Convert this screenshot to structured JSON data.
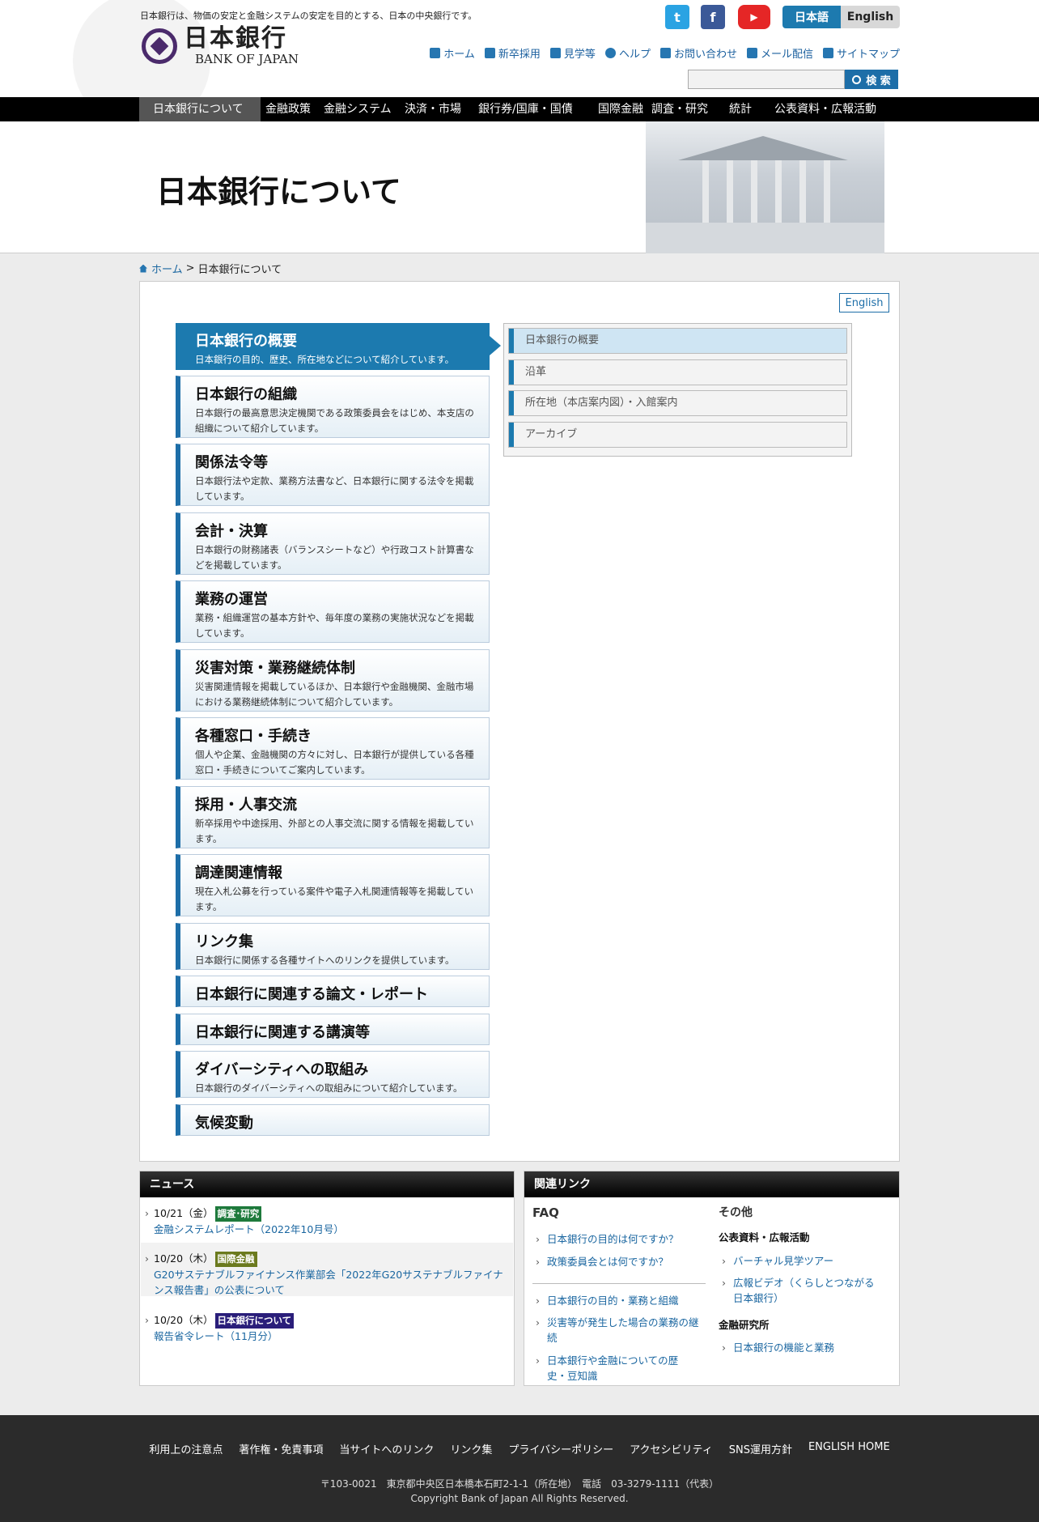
{
  "header": {
    "tagline": "日本銀行は、物価の安定と金融システムの安定を目的とする、日本の中央銀行です。",
    "logo_jp": "日本銀行",
    "logo_en": "BANK OF JAPAN",
    "social": [
      "twitter-icon",
      "facebook-icon",
      "youtube-icon"
    ],
    "lang_ja": "日本語",
    "lang_en": "English",
    "util": [
      "ホーム",
      "新卒採用",
      "見学等",
      "ヘルプ",
      "お問い合わせ",
      "メール配信",
      "サイトマップ"
    ],
    "search_placeholder": "",
    "search_button": "検 索"
  },
  "gnav": [
    "日本銀行について",
    "金融政策",
    "金融システム",
    "決済・市場",
    "銀行券/国庫・国債",
    "国際金融",
    "調査・研究",
    "統計",
    "公表資料・広報活動"
  ],
  "hero_title": "日本銀行について",
  "breadcrumb": {
    "home": "ホーム",
    "sep": ">",
    "current": "日本銀行について"
  },
  "english_button": "English",
  "menu": [
    {
      "title": "日本銀行の概要",
      "desc": "日本銀行の目的、歴史、所在地などについて紹介しています。"
    },
    {
      "title": "日本銀行の組織",
      "desc": "日本銀行の最高意思決定機関である政策委員会をはじめ、本支店の組織について紹介しています。"
    },
    {
      "title": "関係法令等",
      "desc": "日本銀行法や定款、業務方法書など、日本銀行に関する法令を掲載しています。"
    },
    {
      "title": "会計・決算",
      "desc": "日本銀行の財務諸表（バランスシートなど）や行政コスト計算書などを掲載しています。"
    },
    {
      "title": "業務の運営",
      "desc": "業務・組織運営の基本方針や、毎年度の業務の実施状況などを掲載しています。"
    },
    {
      "title": "災害対策・業務継続体制",
      "desc": "災害関連情報を掲載しているほか、日本銀行や金融機関、金融市場における業務継続体制について紹介しています。"
    },
    {
      "title": "各種窓口・手続き",
      "desc": "個人や企業、金融機関の方々に対し、日本銀行が提供している各種窓口・手続きについてご案内しています。"
    },
    {
      "title": "採用・人事交流",
      "desc": "新卒採用や中途採用、外部との人事交流に関する情報を掲載しています。"
    },
    {
      "title": "調達関連情報",
      "desc": "現在入札公募を行っている案件や電子入札関連情報等を掲載しています。"
    },
    {
      "title": "リンク集",
      "desc": "日本銀行に関係する各種サイトへのリンクを提供しています。"
    },
    {
      "title": "日本銀行に関連する論文・レポート",
      "desc": ""
    },
    {
      "title": "日本銀行に関連する講演等",
      "desc": ""
    },
    {
      "title": "ダイバーシティへの取組み",
      "desc": "日本銀行のダイバーシティへの取組みについて紹介しています。"
    },
    {
      "title": "気候変動",
      "desc": ""
    }
  ],
  "submenu": [
    "日本銀行の概要",
    "沿革",
    "所在地（本店案内図）・入館案内",
    "アーカイブ"
  ],
  "news": {
    "title": "ニュース",
    "items": [
      {
        "date": "10/21（金）",
        "tag": "調査･研究",
        "tag_color": "#1e7a3c",
        "text": "金融システムレポート（2022年10月号）"
      },
      {
        "date": "10/20（木）",
        "tag": "国際金融",
        "tag_color": "#6b7a1e",
        "text": "G20サステナブルファイナンス作業部会「2022年G20サステナブルファイナンス報告書」の公表について"
      },
      {
        "date": "10/20（木）",
        "tag": "日本銀行について",
        "tag_color": "#2a1e7a",
        "text": "報告省令レート（11月分）"
      }
    ]
  },
  "related": {
    "title": "関連リンク",
    "faq_head": "FAQ",
    "faq": [
      "日本銀行の目的は何ですか？",
      "政策委員会とは何ですか？",
      "日本銀行の目的・業務と組織",
      "災害等が発生した場合の業務の継続",
      "日本銀行や金融についての歴史・豆知識"
    ],
    "other_head": "その他",
    "pr_head": "公表資料・広報活動",
    "pr": [
      "バーチャル見学ツアー",
      "広報ビデオ（くらしとつながる日本銀行）"
    ],
    "imes_head": "金融研究所",
    "imes": [
      "日本銀行の機能と業務"
    ]
  },
  "footer": {
    "links": [
      "利用上の注意点",
      "著作権・免責事項",
      "当サイトへのリンク",
      "リンク集",
      "プライバシーポリシー",
      "アクセシビリティ",
      "SNS運用方針",
      "ENGLISH HOME"
    ],
    "address_pre": "〒103-0021　東京都中央区日本橋本石町2-1-1（",
    "address_link": "所在地",
    "address_post": "）　電話　03-3279-1111（代表）",
    "copyright": "Copyright Bank of Japan All Rights Reserved."
  }
}
